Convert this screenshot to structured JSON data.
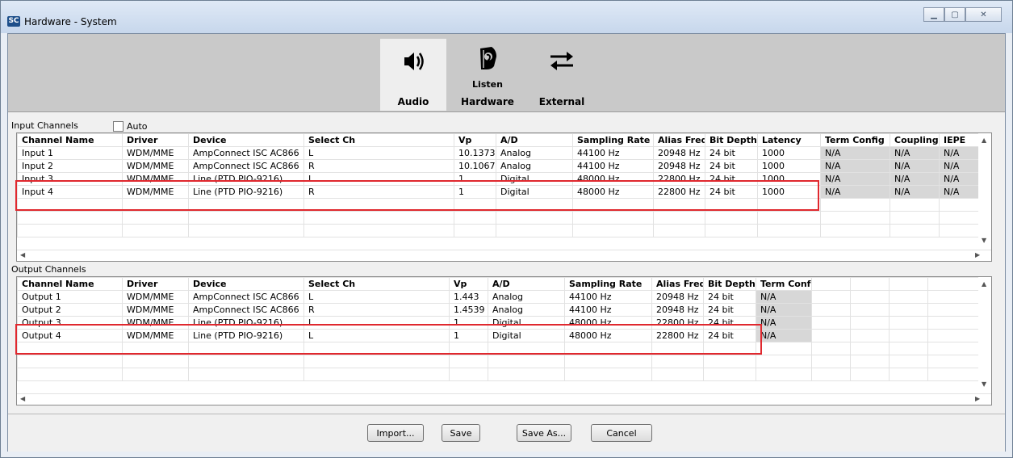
{
  "window": {
    "title": "Hardware - System",
    "logo_text": "SC"
  },
  "toolbar": {
    "audio_label": "Audio",
    "hardware_label": "Hardware",
    "hardware_sublabel": "Listen",
    "external_label": "External"
  },
  "input": {
    "section_label": "Input Channels",
    "auto_label": "Auto",
    "columns": [
      "Channel Name",
      "Driver",
      "Device",
      "Select Ch",
      "Vp",
      "A/D",
      "Sampling Rate",
      "Alias Freq",
      "Bit Depth",
      "Latency",
      "Term Config",
      "Coupling",
      "IEPE"
    ],
    "rows": [
      [
        "Input 1",
        "WDM/MME",
        "AmpConnect ISC AC866",
        "L",
        "10.1373",
        "Analog",
        "44100 Hz",
        "20948 Hz",
        "24 bit",
        "1000",
        "N/A",
        "N/A",
        "N/A"
      ],
      [
        "Input 2",
        "WDM/MME",
        "AmpConnect ISC AC866",
        "R",
        "10.1067",
        "Analog",
        "44100 Hz",
        "20948 Hz",
        "24 bit",
        "1000",
        "N/A",
        "N/A",
        "N/A"
      ],
      [
        "Input 3",
        "WDM/MME",
        "Line (PTD PIO-9216)",
        "L",
        "1",
        "Digital",
        "48000 Hz",
        "22800 Hz",
        "24 bit",
        "1000",
        "N/A",
        "N/A",
        "N/A"
      ],
      [
        "Input 4",
        "WDM/MME",
        "Line (PTD PIO-9216)",
        "R",
        "1",
        "Digital",
        "48000 Hz",
        "22800 Hz",
        "24 bit",
        "1000",
        "N/A",
        "N/A",
        "N/A"
      ]
    ]
  },
  "output": {
    "section_label": "Output Channels",
    "columns": [
      "Channel Name",
      "Driver",
      "Device",
      "Select Ch",
      "Vp",
      "A/D",
      "Sampling Rate",
      "Alias Freq",
      "Bit Depth",
      "Term Conf"
    ],
    "rows": [
      [
        "Output 1",
        "WDM/MME",
        "AmpConnect ISC AC866",
        "L",
        "1.443",
        "Analog",
        "44100 Hz",
        "20948 Hz",
        "24 bit",
        "N/A"
      ],
      [
        "Output 2",
        "WDM/MME",
        "AmpConnect ISC AC866",
        "R",
        "1.4539",
        "Analog",
        "44100 Hz",
        "20948 Hz",
        "24 bit",
        "N/A"
      ],
      [
        "Output 3",
        "WDM/MME",
        "Line (PTD PIO-9216)",
        "L",
        "1",
        "Digital",
        "48000 Hz",
        "22800 Hz",
        "24 bit",
        "N/A"
      ],
      [
        "Output 4",
        "WDM/MME",
        "Line (PTD PIO-9216)",
        "L",
        "1",
        "Digital",
        "48000 Hz",
        "22800 Hz",
        "24 bit",
        "N/A"
      ]
    ]
  },
  "buttons": {
    "import": "Import...",
    "save": "Save",
    "save_as": "Save As...",
    "cancel": "Cancel"
  },
  "colors": {
    "highlight": "#e0282e",
    "na_cell": "#d7d7d7"
  },
  "icons": [
    "speaker-icon",
    "listen-hardware-icon",
    "swap-arrows-icon"
  ]
}
